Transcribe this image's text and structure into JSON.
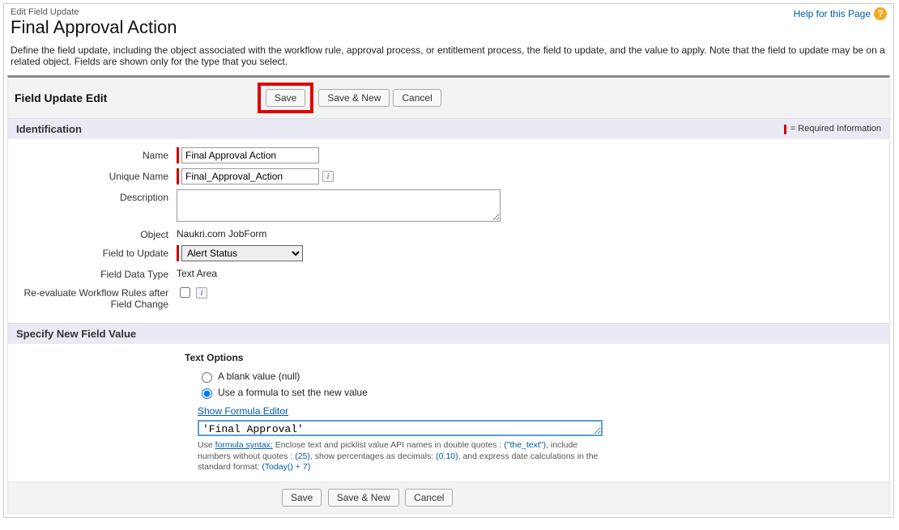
{
  "header": {
    "edit_label": "Edit Field Update",
    "page_title": "Final Approval Action",
    "help_text": "Help for this Page"
  },
  "intro_text": "Define the field update, including the object associated with the workflow rule, approval process, or entitlement process, the field to update, and the value to apply. Note that the field to update may be on a related object. Fields are shown only for the type that you select.",
  "panel": {
    "title": "Field Update Edit",
    "save": "Save",
    "save_new": "Save & New",
    "cancel": "Cancel"
  },
  "identification": {
    "section_title": "Identification",
    "required_text": "= Required Information",
    "name_label": "Name",
    "name_value": "Final Approval Action",
    "unique_label": "Unique Name",
    "unique_value": "Final_Approval_Action",
    "description_label": "Description",
    "description_value": "",
    "object_label": "Object",
    "object_value": "Naukri.com JobForm",
    "field_to_update_label": "Field to Update",
    "field_to_update_value": "Alert Status",
    "field_data_type_label": "Field Data Type",
    "field_data_type_value": "Text Area",
    "reeval_label": "Re-evaluate Workflow Rules after Field Change"
  },
  "specify": {
    "section_title": "Specify New Field Value",
    "text_options_title": "Text Options",
    "radio_blank": "A blank value (null)",
    "radio_formula": "Use a formula to set the new value",
    "radio_selected": "formula",
    "show_editor": "Show Formula Editor",
    "formula_value": "'Final Approval'",
    "hint_prefix": "Use ",
    "hint_link": "formula syntax:",
    "hint_mid1": " Enclose text and picklist value API names in double quotes : ",
    "hint_ex1": "(\"the_text\")",
    "hint_mid2": ", include numbers without quotes : ",
    "hint_ex2": "(25)",
    "hint_mid3": ", show percentages as decimals: ",
    "hint_ex3": "(0.10)",
    "hint_mid4": ", and express date calculations in the standard format: ",
    "hint_ex4": "(Today() + 7)"
  }
}
